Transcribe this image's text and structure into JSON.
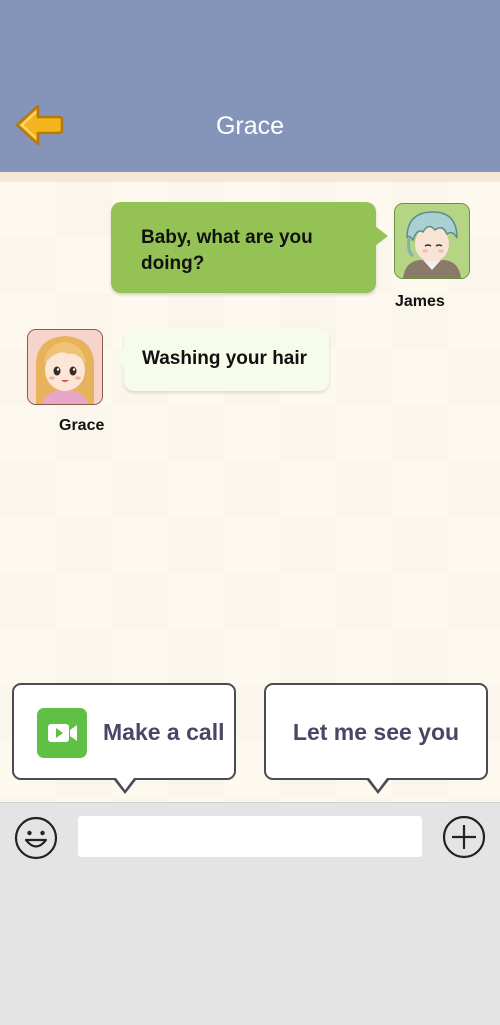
{
  "header": {
    "title": "Grace",
    "back_icon": "back-arrow-icon",
    "background_color": "#8595b9"
  },
  "messages": [
    {
      "sender": "James",
      "text": "Baby, what are you doing?",
      "side": "right",
      "bubble_color": "#95c254"
    },
    {
      "sender": "Grace",
      "text": "Washing your hair",
      "side": "left",
      "bubble_color": "#f7fbea"
    }
  ],
  "options": {
    "call": {
      "label": "Make a call",
      "icon": "video-call-icon",
      "icon_color": "#5fc043"
    },
    "see": {
      "label": "Let me see you"
    }
  },
  "input_bar": {
    "emoji_icon": "emoji-face-icon",
    "add_icon": "plus-circle-icon",
    "input_value": ""
  }
}
